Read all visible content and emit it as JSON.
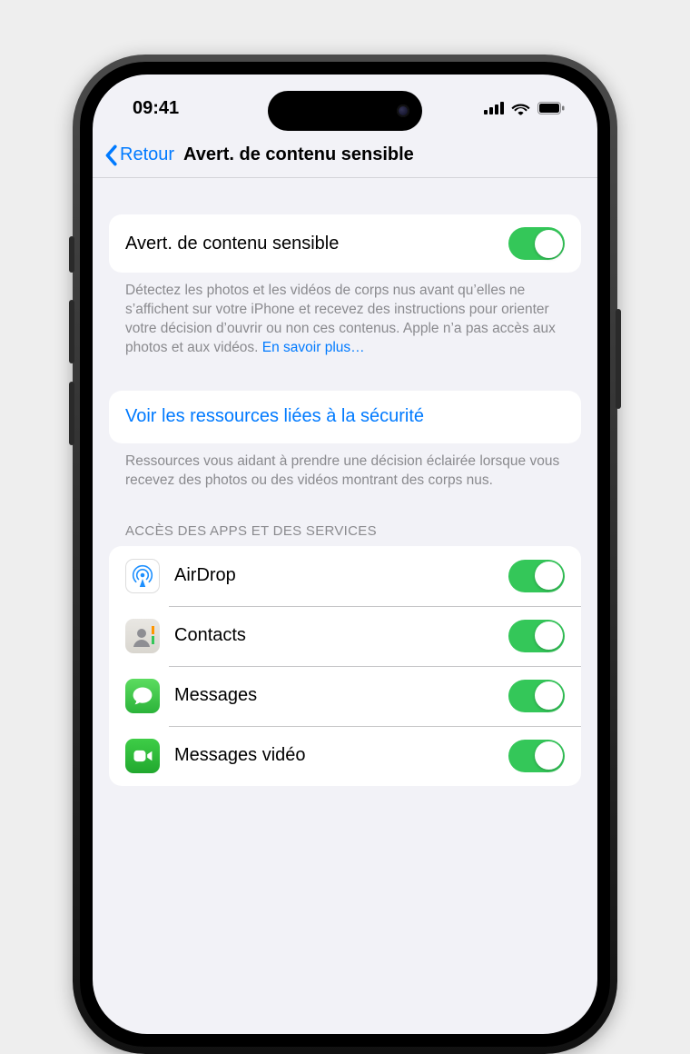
{
  "status": {
    "time": "09:41"
  },
  "nav": {
    "back": "Retour",
    "title": "Avert. de contenu sensible"
  },
  "main": {
    "toggle_label": "Avert. de contenu sensible",
    "toggle_on": true,
    "description": "Détectez les photos et les vidéos de corps nus avant qu’elles ne s’affichent sur votre iPhone et recevez des instructions pour orienter votre décision d’ouvrir ou non ces contenus. Apple n’a pas accès aux photos et aux vidéos. ",
    "learn_more": "En savoir plus…"
  },
  "resources": {
    "link": "Voir les ressources liées à la sécurité",
    "footer": "Ressources vous aidant à prendre une décision éclairée lorsque vous recevez des photos ou des vidéos montrant des corps nus."
  },
  "apps": {
    "header": "ACCÈS DES APPS ET DES SERVICES",
    "items": [
      {
        "name": "AirDrop",
        "icon": "airdrop-icon",
        "on": true
      },
      {
        "name": "Contacts",
        "icon": "contacts-icon",
        "on": true
      },
      {
        "name": "Messages",
        "icon": "messages-icon",
        "on": true
      },
      {
        "name": "Messages vidéo",
        "icon": "facetime-icon",
        "on": true
      }
    ]
  }
}
